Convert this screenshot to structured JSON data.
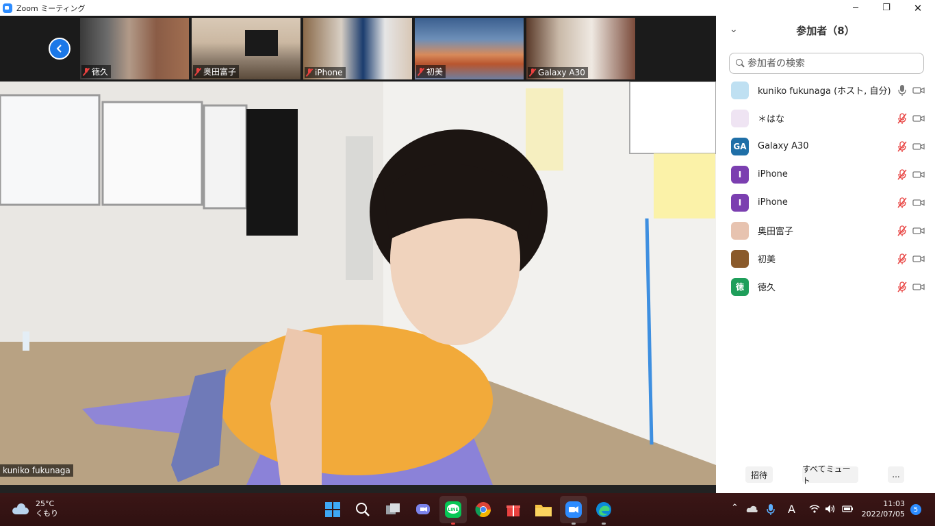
{
  "window": {
    "title": "Zoom ミーティング",
    "minimize": "─",
    "maximize": "❐",
    "close": "✕"
  },
  "gallery": [
    {
      "name": "徳久",
      "muted": true
    },
    {
      "name": "奥田富子",
      "muted": true
    },
    {
      "name": "iPhone",
      "muted": true
    },
    {
      "name": "初美",
      "muted": true
    },
    {
      "name": "Galaxy A30",
      "muted": true
    }
  ],
  "main_video": {
    "speaker_name": "kuniko fukunaga"
  },
  "panel": {
    "title": "参加者（8）",
    "search_placeholder": "参加者の検索",
    "participants": [
      {
        "name": "kuniko fukunaga (ホスト, 自分)",
        "avatar_text": "",
        "avatar_color": "#bfe0f2",
        "mic": "on"
      },
      {
        "name": "＊はな",
        "avatar_text": "",
        "avatar_color": "#efe4f3",
        "mic": "off"
      },
      {
        "name": "Galaxy A30",
        "avatar_text": "GA",
        "avatar_color": "#1f6fa7",
        "mic": "off"
      },
      {
        "name": "iPhone",
        "avatar_text": "I",
        "avatar_color": "#7b3fb0",
        "mic": "off"
      },
      {
        "name": "iPhone",
        "avatar_text": "I",
        "avatar_color": "#7b3fb0",
        "mic": "off"
      },
      {
        "name": "奥田富子",
        "avatar_text": "",
        "avatar_color": "#e7c3b0",
        "mic": "off"
      },
      {
        "name": "初美",
        "avatar_text": "",
        "avatar_color": "#8a5a2b",
        "mic": "off"
      },
      {
        "name": "徳久",
        "avatar_text": "徳",
        "avatar_color": "#1e9e5a",
        "mic": "off"
      }
    ],
    "footer": {
      "invite": "招待",
      "mute_all": "すべてミュート",
      "more": "..."
    }
  },
  "taskbar": {
    "weather_temp": "25°C",
    "weather_desc": "くもり",
    "time": "11:03",
    "date": "2022/07/05",
    "notification_count": "5",
    "ime_mode": "A"
  },
  "colors": {
    "accent": "#2d8cff",
    "mute_red": "#e8413f"
  }
}
